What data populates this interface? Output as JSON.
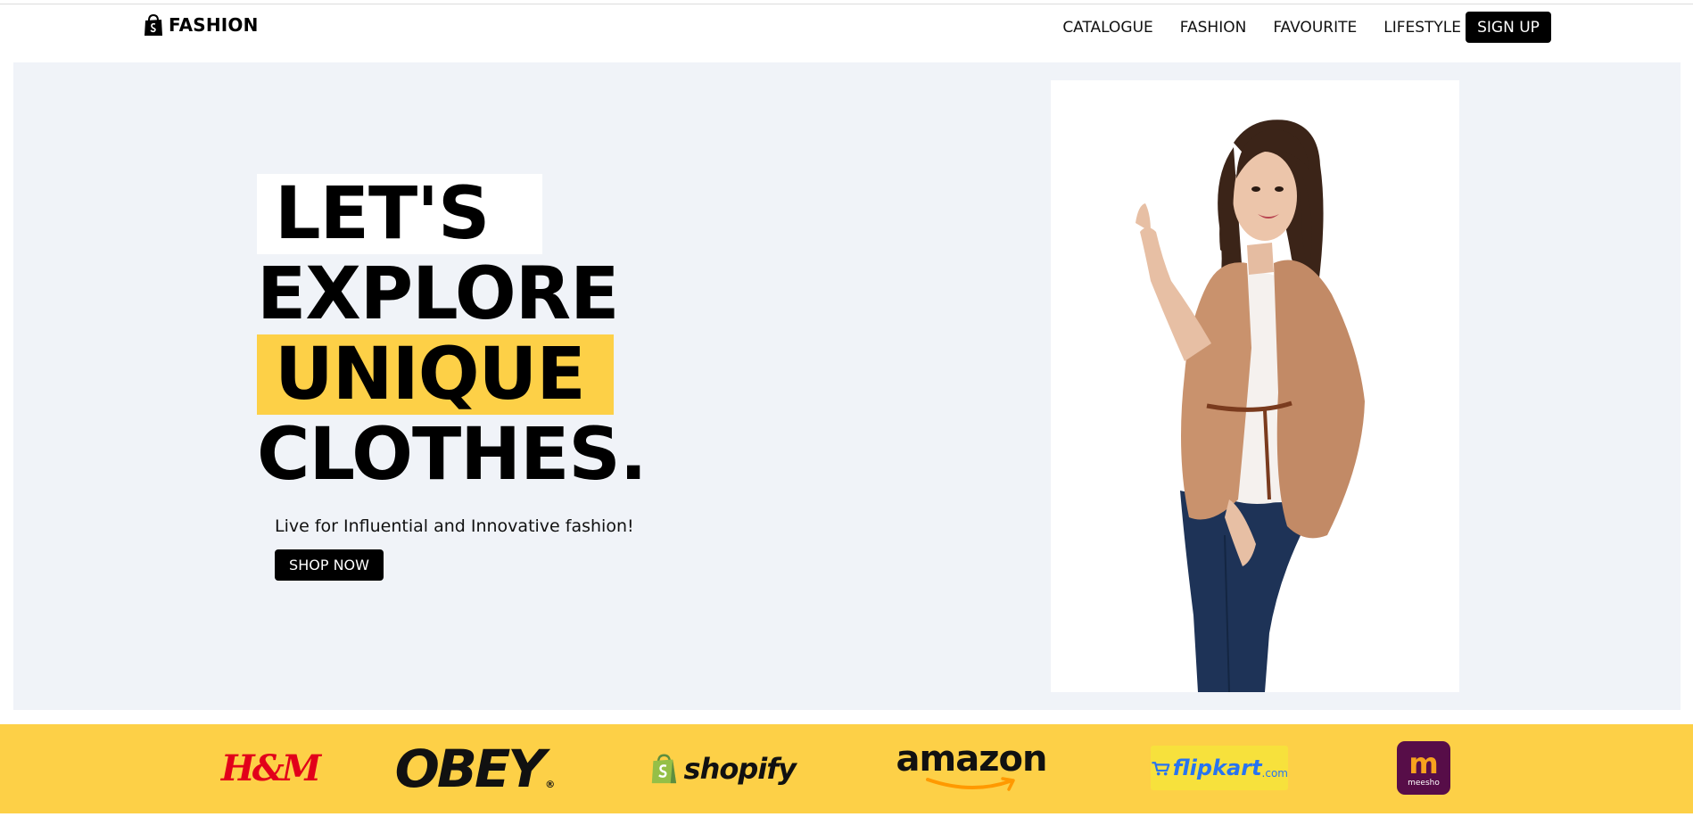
{
  "brand": {
    "name": "FASHION",
    "icon": "shopping-bag-icon"
  },
  "nav": {
    "links": [
      {
        "label": "CATALOGUE"
      },
      {
        "label": "FASHION"
      },
      {
        "label": "FAVOURITE"
      },
      {
        "label": "LIFESTYLE"
      }
    ],
    "signup_label": "SIGN UP"
  },
  "hero": {
    "headline": [
      "LET'S",
      "EXPLORE",
      "UNIQUE",
      "CLOTHES."
    ],
    "tagline": "Live for Influential and Innovative fashion!",
    "cta_label": "SHOP NOW"
  },
  "brands": {
    "hm": "H&M",
    "obey": "OBEY",
    "obey_mark": "®",
    "shopify": "shopify",
    "amazon": "amazon",
    "flipkart": "flipkart",
    "flipkart_suffix": ".com",
    "meesho_mark": "m",
    "meesho": "meesho"
  },
  "colors": {
    "accent_yellow": "#fdd047",
    "hero_bg": "#f0f3f8",
    "button_bg": "#000000",
    "hm_red": "#e2001a",
    "shopify_green": "#95bf47",
    "amazon_orange": "#ff9900",
    "flipkart_blue": "#2874f0",
    "meesho_purple": "#570d48"
  }
}
